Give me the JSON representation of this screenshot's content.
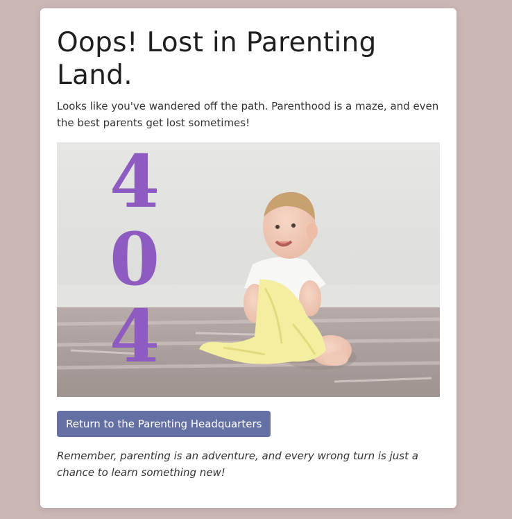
{
  "page": {
    "title": "Oops! Lost in Parenting Land.",
    "lead": "Looks like you've wandered off the path. Parenthood is a maze, and even the best parents get lost sometimes!",
    "error_digits": [
      "4",
      "0",
      "4"
    ],
    "cta_label": "Return to the Parenting Headquarters",
    "note": "Remember, parenting is an adventure, and every wrong turn is just a chance to learn something new!"
  },
  "colors": {
    "page_bg": "#cbb8b6",
    "card_bg": "#ffffff",
    "accent_button": "#6470a4",
    "digit_purple": "#8e5cc1"
  }
}
